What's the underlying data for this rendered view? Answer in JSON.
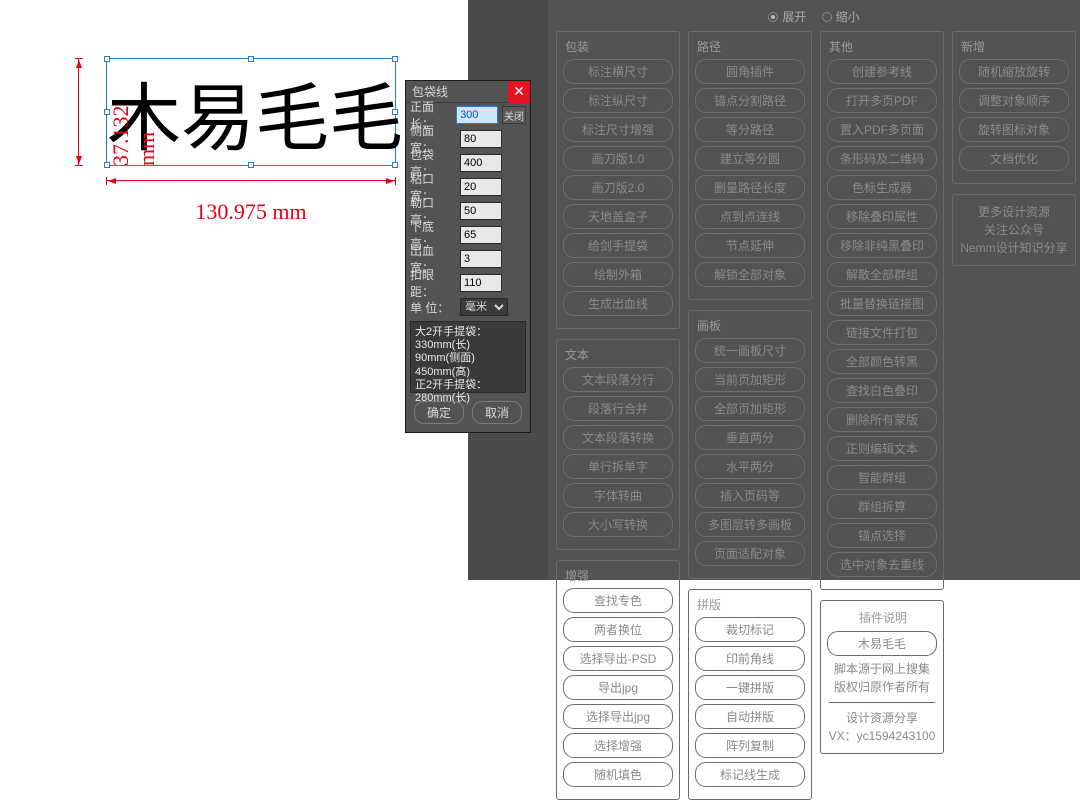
{
  "canvas": {
    "text_sample": "木易毛毛",
    "dim_width_label": "130.975 mm",
    "dim_height_label": "37.132 mm"
  },
  "dialog": {
    "title": "包袋线",
    "close_aux": "关闭",
    "fields": {
      "front_len": {
        "label": "正面长：",
        "value": "300"
      },
      "side_width": {
        "label": "侧面宽：",
        "value": "80"
      },
      "bag_height": {
        "label": "包袋高：",
        "value": "400"
      },
      "glue_width": {
        "label": "粘口宽：",
        "value": "20"
      },
      "strap_height": {
        "label": "勒口高：",
        "value": "50"
      },
      "bottom_height": {
        "label": "下底高：",
        "value": "65"
      },
      "bleed_width": {
        "label": "出血宽：",
        "value": "3"
      },
      "hole_dist": {
        "label": "扣眼距：",
        "value": "110"
      }
    },
    "unit_label": "单  位：",
    "unit_value": "毫米",
    "info_lines": [
      "大2开手提袋：",
      "330mm(长)",
      "90mm(侧面)",
      "450mm(高)",
      "正2开手提袋：",
      "280mm(长)"
    ],
    "ok": "确定",
    "cancel": "取消"
  },
  "panel": {
    "expand": "展开",
    "shrink": "缩小",
    "groups": {
      "packaging": {
        "title": "包装",
        "items": [
          "标注横尺寸",
          "标注纵尺寸",
          "标注尺寸增强",
          "画刀版1.0",
          "画刀版2.0",
          "天地盖盒子",
          "给剑手提袋",
          "绘制外箱",
          "生成出血线"
        ]
      },
      "text": {
        "title": "文本",
        "items": [
          "文本段落分行",
          "段落行合并",
          "文本段落转换",
          "单行拆单字",
          "字体转曲",
          "大小写转换"
        ]
      },
      "enhance": {
        "title": "增强",
        "items": [
          "查找专色",
          "两者换位",
          "选择导出-PSD",
          "导出jpg",
          "选择导出jpg",
          "选择增强",
          "随机填色"
        ]
      },
      "path": {
        "title": "路径",
        "items": [
          "圆角插件",
          "锚点分割路径",
          "等分路径",
          "建立等分圆",
          "删量路径长度",
          "点到点连线",
          "节点延伸",
          "解锁全部对象"
        ]
      },
      "artboard": {
        "title": "画板",
        "items": [
          "统一画板尺寸",
          "当前页加矩形",
          "全部页加矩形",
          "垂直两分",
          "水平两分",
          "插入页码等",
          "多图层转多画板",
          "页面适配对象"
        ]
      },
      "collage": {
        "title": "拼版",
        "items": [
          "裁切标记",
          "印前角线",
          "一键拼版",
          "自动拼版",
          "阵列复制",
          "标记线生成"
        ]
      },
      "other": {
        "title": "其他",
        "items": [
          "创建参考线",
          "打开多页PDF",
          "置入PDF多页面",
          "条形码及二维码",
          "色标生成器",
          "移除叠印属性",
          "移除非纯黑叠印",
          "解散全部群组",
          "批量替换链接图",
          "链接文件打包",
          "全部颜色转黑",
          "查找白色叠印",
          "删除所有蒙版",
          "正则编辑文本",
          "智能群组",
          "群组拆算",
          "锚点选择",
          "选中对象去重线"
        ]
      },
      "newadd": {
        "title": "新增",
        "items": [
          "随机缩放旋转",
          "调整对象顺序",
          "旋转图标对象",
          "文档优化"
        ]
      }
    },
    "resources": {
      "line1": "更多设计资源",
      "line2": "关注公众号",
      "line3": "Nemm设计知识分享"
    },
    "plugin_info": {
      "title": "插件说明",
      "name": "木易毛毛",
      "line1": "脚本源于网上搜集",
      "line2": "版权归原作者所有",
      "divider_label": "设计资源分享",
      "vx": "VX：yc1594243100"
    }
  }
}
